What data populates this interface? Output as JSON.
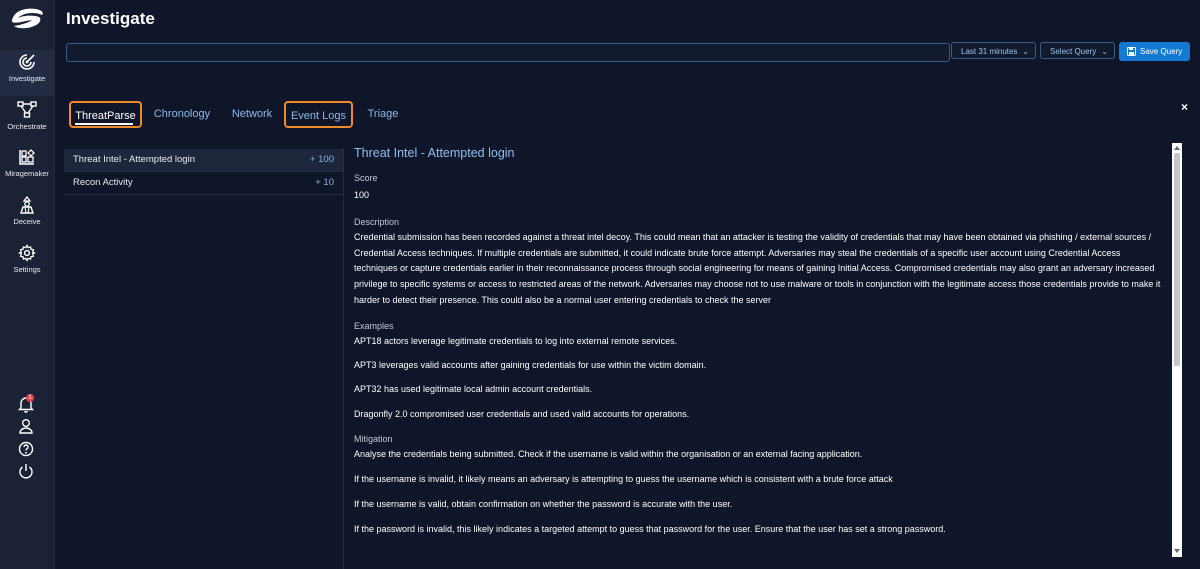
{
  "sidebar": {
    "items": [
      {
        "label": "Investigate",
        "icon": "investigate-icon"
      },
      {
        "label": "Orchestrate",
        "icon": "orchestrate-icon"
      },
      {
        "label": "Miragemaker",
        "icon": "miragemaker-icon"
      },
      {
        "label": "Deceive",
        "icon": "deceive-icon"
      },
      {
        "label": "Settings",
        "icon": "gear-icon"
      }
    ],
    "notification_count": "1"
  },
  "header": {
    "title": "Investigate",
    "query_value": "",
    "time_range": "Last 31 minutes",
    "select_query": "Select Query",
    "save_query": "Save Query"
  },
  "tabs": [
    {
      "label": "ThreatParse"
    },
    {
      "label": "Chronology"
    },
    {
      "label": "Network"
    },
    {
      "label": "Event Logs"
    },
    {
      "label": "Triage"
    }
  ],
  "close_label": "×",
  "list": [
    {
      "label": "Threat Intel - Attempted login",
      "score": "+ 100"
    },
    {
      "label": "Recon Activity",
      "score": "+ 10"
    }
  ],
  "detail": {
    "title": "Threat Intel - Attempted login",
    "score_label": "Score",
    "score_value": "100",
    "description_label": "Description",
    "description": "Credential submission has been recorded against a threat intel decoy. This could mean that an attacker is testing the validity of credentials that may have been obtained via phishing / external sources / Credential Access techniques. If multiple credentials are submitted, it could indicate brute force attempt. Adversaries may steal the credentials of a specific user account using Credential Access techniques or capture credentials earlier in their reconnaissance process through social engineering for means of gaining Initial Access. Compromised credentials may also grant an adversary increased privilege to specific systems or access to restricted areas of the network. Adversaries may choose not to use malware or tools in conjunction with the legitimate access those credentials provide to make it harder to detect their presence. This could also be a normal user entering credentials to check the server",
    "examples_label": "Examples",
    "examples": [
      "APT18 actors leverage legitimate credentials to log into external remote services.",
      "APT3 leverages valid accounts after gaining credentials for use within the victim domain.",
      "APT32 has used legitimate local admin account credentials.",
      "Dragonfly 2.0 compromised user credentials and used valid accounts for operations."
    ],
    "mitigation_label": "Mitigation",
    "mitigation": [
      "Analyse the credentials being submitted. Check if the username is valid within the organisation or an external facing application.",
      "If the username is invalid, it likely means an adversary is attempting to guess the username which is consistent with a brute force attack",
      "If the username is valid, obtain confirmation on whether the password is accurate with the user.",
      "If the password is invalid, this likely indicates a targeted attempt to guess that password for the user. Ensure that the user has set a strong password."
    ]
  },
  "colors": {
    "background": "#0f1629",
    "sidebar": "#1b2236",
    "accent": "#1479d2",
    "tab_highlight": "#f08a2a",
    "link": "#8cb8ea"
  }
}
